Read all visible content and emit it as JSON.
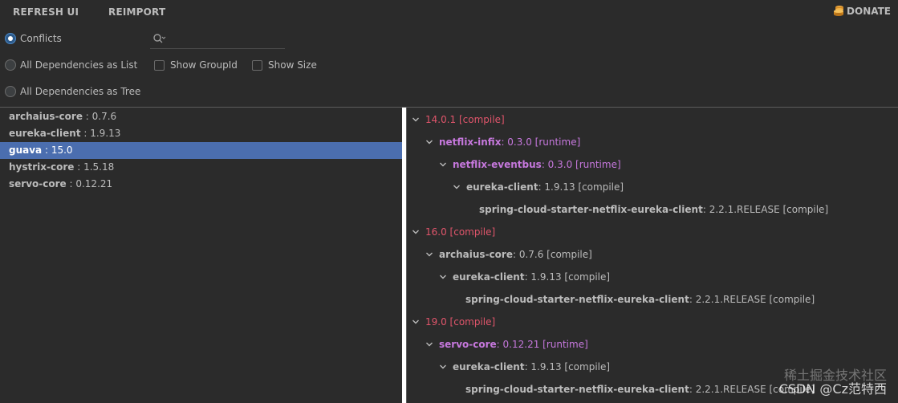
{
  "toolbar": {
    "refresh_label": "REFRESH UI",
    "reimport_label": "REIMPORT",
    "donate_label": "DONATE"
  },
  "view_options": {
    "conflicts": "Conflicts",
    "as_list": "All Dependencies as List",
    "as_tree": "All Dependencies as Tree",
    "selected": "Conflicts"
  },
  "checkboxes": {
    "show_group_id": "Show GroupId",
    "show_size": "Show Size"
  },
  "search": {
    "value": "",
    "placeholder": ""
  },
  "left_list": [
    {
      "name": "archaius-core",
      "version": " : 0.7.6"
    },
    {
      "name": "eureka-client",
      "version": " : 1.9.13"
    },
    {
      "name": "guava",
      "version": " : 15.0",
      "selected": true
    },
    {
      "name": "hystrix-core",
      "version": " : 1.5.18"
    },
    {
      "name": "servo-core",
      "version": " : 0.12.21"
    }
  ],
  "tree": [
    {
      "label": "14.0.1 [compile]"
    },
    {
      "name": "netflix-infix",
      "rest": " : 0.3.0 [runtime]"
    },
    {
      "name": "netflix-eventbus",
      "rest": " : 0.3.0 [runtime]"
    },
    {
      "name": "eureka-client",
      "rest": " : 1.9.13 [compile]"
    },
    {
      "name": "spring-cloud-starter-netflix-eureka-client",
      "rest": " : 2.2.1.RELEASE [compile]"
    },
    {
      "label": "16.0 [compile]"
    },
    {
      "name": "archaius-core",
      "rest": " : 0.7.6 [compile]"
    },
    {
      "name": "eureka-client",
      "rest": " : 1.9.13 [compile]"
    },
    {
      "name": "spring-cloud-starter-netflix-eureka-client",
      "rest": " : 2.2.1.RELEASE [compile]"
    },
    {
      "label": "19.0 [compile]"
    },
    {
      "name": "servo-core",
      "rest": " : 0.12.21 [runtime]"
    },
    {
      "name": "eureka-client",
      "rest": " : 1.9.13 [compile]"
    },
    {
      "name": "spring-cloud-starter-netflix-eureka-client",
      "rest": " : 2.2.1.RELEASE [compile]"
    }
  ],
  "watermark": {
    "line1": "稀土掘金技术社区",
    "line2": "CSDN @Cz范特西"
  },
  "colors": {
    "conflict_version": "#e0556b",
    "runtime_scope": "#c678dd",
    "selection": "#4b6eaf",
    "background": "#2b2b2b"
  },
  "icons": {
    "donate": "coin-stack-icon",
    "search": "search-icon",
    "expand": "chevron-down-icon"
  }
}
